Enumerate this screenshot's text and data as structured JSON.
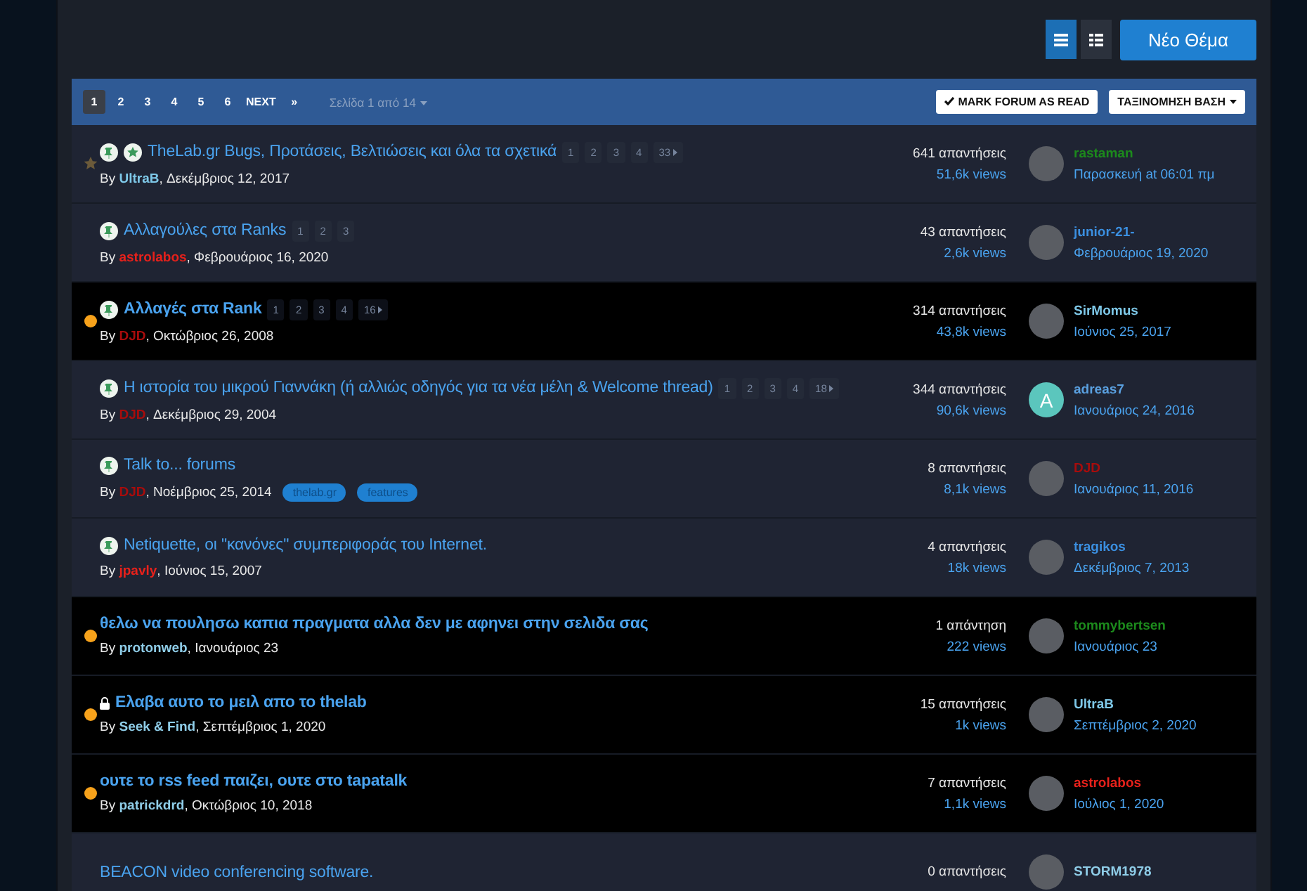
{
  "toolbar": {
    "view_buttons": [
      {
        "selected": true
      },
      {
        "selected": false
      }
    ],
    "new_topic": "Νέο Θέμα"
  },
  "pagination": {
    "pages": [
      {
        "label": "1",
        "selected": true
      },
      {
        "label": "2",
        "selected": false
      },
      {
        "label": "3",
        "selected": false
      },
      {
        "label": "4",
        "selected": false
      },
      {
        "label": "5",
        "selected": false
      },
      {
        "label": "6",
        "selected": false
      }
    ],
    "next": "NEXT",
    "last": "»",
    "page_of": "Σελίδα 1 από 14",
    "mark_read": "MARK FORUM AS READ",
    "sort": "ΤΑΞΙΝΟΜΗΣΗ ΒΑΣΗ"
  },
  "topics": [
    {
      "unread": false,
      "featured": true,
      "pinned": true,
      "locked": false,
      "title": "TheLab.gr Bugs, Προτάσεις, Βελτιώσεις και όλα τα σχετικά",
      "pages": [
        "1",
        "2",
        "3",
        "4",
        "33"
      ],
      "by": "By",
      "author": {
        "name": "UltraB",
        "color": "#7ec8e8"
      },
      "date": ", Δεκέμβριος 12, 2017",
      "replies": "641 απαντήσεις",
      "views": "51,6k views",
      "last_poster": {
        "name": "rastaman",
        "color": "#1c8a1c"
      },
      "last_date": "Παρασκευή at 06:01 πμ"
    },
    {
      "unread": false,
      "featured": false,
      "pinned": true,
      "locked": false,
      "title": "Αλλαγούλες στα Ranks",
      "pages": [
        "1",
        "2",
        "3"
      ],
      "by": "By",
      "author": {
        "name": "astrolabos",
        "color": "#e8211b"
      },
      "date": ", Φεβρουάριος 16, 2020",
      "replies": "43 απαντήσεις",
      "views": "2,6k views",
      "last_poster": {
        "name": "junior-21-",
        "color": "#3b8fe0"
      },
      "last_date": "Φεβρουάριος 19, 2020"
    },
    {
      "unread": true,
      "featured": false,
      "pinned": true,
      "locked": false,
      "title": "Αλλαγές στα Rank",
      "pages": [
        "1",
        "2",
        "3",
        "4",
        "16"
      ],
      "by": "By",
      "author": {
        "name": "DJD",
        "color": "#a80c0c"
      },
      "date": ", Οκτώβριος 26, 2008",
      "replies": "314 απαντήσεις",
      "views": "43,8k views",
      "last_poster": {
        "name": "SirMomus",
        "color": "#7ec8e8"
      },
      "last_date": "Ιούνιος 25, 2017"
    },
    {
      "unread": false,
      "featured": false,
      "pinned": true,
      "locked": false,
      "title": "Η ιστορία του μικρού Γιαννάκη (ή αλλιώς οδηγός για τα νέα μέλη & Welcome thread)",
      "pages": [
        "1",
        "2",
        "3",
        "4",
        "18"
      ],
      "by": "By",
      "author": {
        "name": "DJD",
        "color": "#a80c0c"
      },
      "date": ", Δεκέμβριος 29, 2004",
      "replies": "344 απαντήσεις",
      "views": "90,6k views",
      "last_poster": {
        "name": "adreas7",
        "color": "#5aa0e0"
      },
      "avatar_letter": "A",
      "last_date": "Ιανουάριος 24, 2016"
    },
    {
      "unread": false,
      "featured": false,
      "pinned": true,
      "locked": false,
      "title": "Talk to... forums",
      "tags": [
        "thelab.gr",
        "features"
      ],
      "by": "By",
      "author": {
        "name": "DJD",
        "color": "#a80c0c"
      },
      "date": ", Νοέμβριος 25, 2014",
      "replies": "8 απαντήσεις",
      "views": "8,1k views",
      "last_poster": {
        "name": "DJD",
        "color": "#a80c0c"
      },
      "last_date": "Ιανουάριος 11, 2016"
    },
    {
      "unread": false,
      "featured": false,
      "pinned": true,
      "locked": false,
      "title": "Netiquette, οι \"κανόνες\" συμπεριφοράς του Internet.",
      "by": "By",
      "author": {
        "name": "jpavly",
        "color": "#e8211b"
      },
      "date": ", Ιούνιος 15, 2007",
      "replies": "4 απαντήσεις",
      "views": "18k views",
      "last_poster": {
        "name": "tragikos",
        "color": "#3b8fe0"
      },
      "last_date": "Δεκέμβριος 7, 2013"
    },
    {
      "unread": true,
      "featured": false,
      "pinned": false,
      "locked": false,
      "title": "θελω να πουλησω καπια πραγματα αλλα δεν με αφηνει στην σελιδα σας",
      "by": "By",
      "author": {
        "name": "protonweb",
        "color": "#8fcde8"
      },
      "date": ", Ιανουάριος 23",
      "replies": "1 απάντηση",
      "views": "222 views",
      "last_poster": {
        "name": "tommybertsen",
        "color": "#1c8a1c"
      },
      "last_date": "Ιανουάριος 23"
    },
    {
      "unread": true,
      "featured": false,
      "pinned": false,
      "locked": true,
      "title": "Ελαβα αυτο το μειλ απο το thelab",
      "by": "By",
      "author": {
        "name": "Seek & Find",
        "color": "#8fcde8"
      },
      "date": ", Σεπτέμβριος 1, 2020",
      "replies": "15 απαντήσεις",
      "views": "1k views",
      "last_poster": {
        "name": "UltraB",
        "color": "#7ec8e8"
      },
      "last_date": "Σεπτέμβριος 2, 2020"
    },
    {
      "unread": true,
      "featured": false,
      "pinned": false,
      "locked": false,
      "title": "ουτε το rss feed παιζει, ουτε στο tapatalk",
      "by": "By",
      "author": {
        "name": "patrickdrd",
        "color": "#8fcde8"
      },
      "date": ", Οκτώβριος 10, 2018",
      "replies": "7 απαντήσεις",
      "views": "1,1k views",
      "last_poster": {
        "name": "astrolabos",
        "color": "#e8211b"
      },
      "last_date": "Ιούλιος 1, 2020"
    },
    {
      "unread": false,
      "featured": false,
      "pinned": false,
      "locked": false,
      "title": "BEACON video conferencing software.",
      "replies": "0 απαντήσεις",
      "last_poster": {
        "name": "STORM1978",
        "color": "#8fcde8"
      }
    }
  ]
}
